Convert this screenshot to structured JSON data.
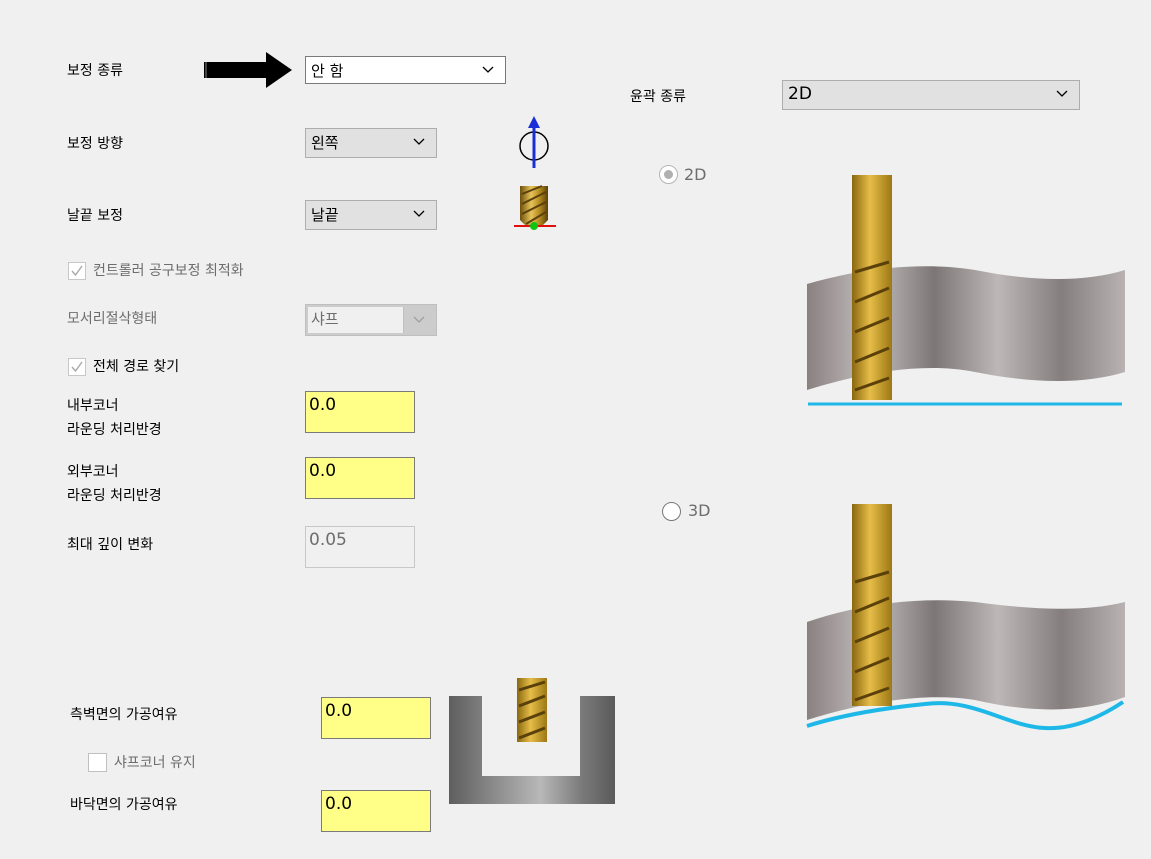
{
  "compensation": {
    "type_label": "보정 종류",
    "type_value": "안 함",
    "direction_label": "보정 방향",
    "direction_value": "왼쪽",
    "tip_label": "날끝 보정",
    "tip_value": "날끝",
    "optimize_checkbox_label": "컨트롤러 공구보정 최적화",
    "corner_type_label": "모서리절삭형태",
    "corner_type_value": "샤프",
    "full_path_checkbox_label": "전체 경로 찾기",
    "inner_corner_label_line1": "내부코너",
    "inner_corner_label_line2": "라운딩 처리반경",
    "inner_corner_value": "0.0",
    "outer_corner_label_line1": "외부코너",
    "outer_corner_label_line2": "라운딩 처리반경",
    "outer_corner_value": "0.0",
    "max_depth_label": "최대 깊이 변화",
    "max_depth_value": "0.05"
  },
  "contour": {
    "type_label": "윤곽 종류",
    "type_value": "2D",
    "radio_2d_label": "2D",
    "radio_3d_label": "3D",
    "selected": "2D"
  },
  "stock": {
    "wall_label": "측벽면의 가공여유",
    "wall_value": "0.0",
    "sharp_corner_label": "샤프코너 유지",
    "floor_label": "바닥면의 가공여유",
    "floor_value": "0.0"
  },
  "colors": {
    "input_yellow": "#ffff88",
    "tool_gold": "#c9a227",
    "path_cyan": "#1eb8e8",
    "arrow_blue": "#1a2fd8"
  }
}
